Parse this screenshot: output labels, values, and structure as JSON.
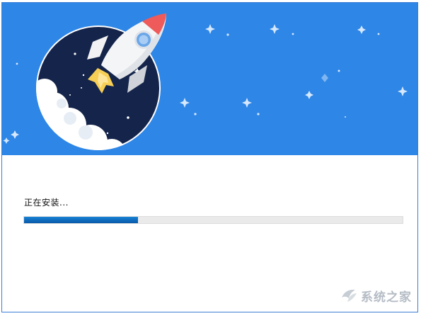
{
  "installer": {
    "status_text": "正在安装...",
    "progress": {
      "percent": 30
    }
  },
  "watermark": {
    "text": "系统之家"
  },
  "colors": {
    "banner": "#2e86e6",
    "progress_fill": "#1276c8",
    "progress_track": "#eaeaea"
  }
}
